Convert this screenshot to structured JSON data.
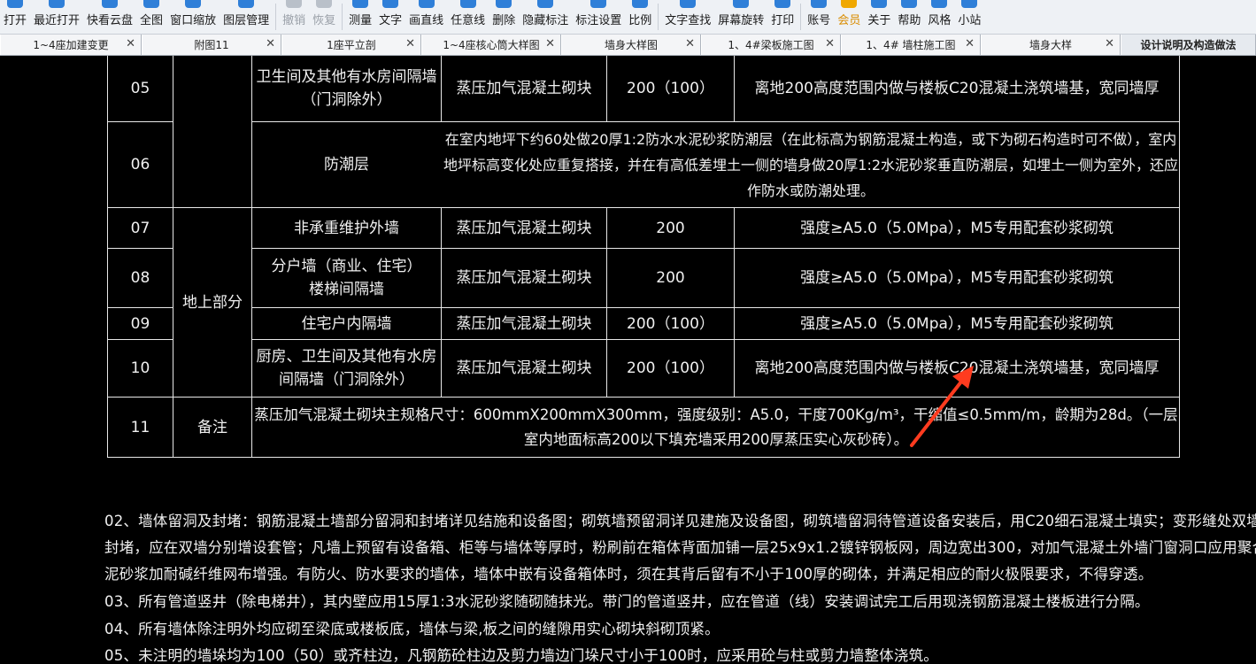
{
  "toolbar": {
    "buttons": [
      {
        "label": "打开",
        "icon": "folder-open-icon",
        "enabled": true
      },
      {
        "label": "最近打开",
        "icon": "recent-files-icon",
        "enabled": true
      },
      {
        "label": "快看云盘",
        "icon": "cloud-icon",
        "enabled": true
      },
      {
        "label": "全图",
        "icon": "fit-all-icon",
        "enabled": true
      },
      {
        "label": "窗口缩放",
        "icon": "zoom-window-icon",
        "enabled": true
      },
      {
        "label": "图层管理",
        "icon": "layers-icon",
        "enabled": true
      },
      {
        "label": "撤销",
        "icon": "undo-icon",
        "enabled": false
      },
      {
        "label": "恢复",
        "icon": "redo-icon",
        "enabled": false
      },
      {
        "label": "测量",
        "icon": "ruler-icon",
        "enabled": true
      },
      {
        "label": "文字",
        "icon": "text-icon",
        "enabled": true
      },
      {
        "label": "画直线",
        "icon": "line-icon",
        "enabled": true
      },
      {
        "label": "任意线",
        "icon": "freehand-icon",
        "enabled": true
      },
      {
        "label": "删除",
        "icon": "delete-icon",
        "enabled": true
      },
      {
        "label": "隐藏标注",
        "icon": "hide-annotation-icon",
        "enabled": true
      },
      {
        "label": "标注设置",
        "icon": "annotation-settings-icon",
        "enabled": true
      },
      {
        "label": "比例",
        "icon": "scale-icon",
        "enabled": true
      },
      {
        "label": "文字查找",
        "icon": "text-search-icon",
        "enabled": true
      },
      {
        "label": "屏幕旋转",
        "icon": "rotate-screen-icon",
        "enabled": true
      },
      {
        "label": "打印",
        "icon": "print-icon",
        "enabled": true
      },
      {
        "label": "账号",
        "icon": "account-icon",
        "enabled": true
      },
      {
        "label": "会员",
        "icon": "vip-icon",
        "enabled": true
      },
      {
        "label": "关于",
        "icon": "about-icon",
        "enabled": true
      },
      {
        "label": "帮助",
        "icon": "help-icon",
        "enabled": true
      },
      {
        "label": "风格",
        "icon": "style-icon",
        "enabled": true
      },
      {
        "label": "小站",
        "icon": "station-icon",
        "enabled": true
      }
    ]
  },
  "tabs": [
    {
      "label": "1~4座加建变更"
    },
    {
      "label": "附图11"
    },
    {
      "label": "1座平立剖"
    },
    {
      "label": "1~4座核心筒大样图"
    },
    {
      "label": "墙身大样图"
    },
    {
      "label": "1、4#梁板施工图"
    },
    {
      "label": "1、4# 墙柱施工图"
    },
    {
      "label": "墙身大样"
    },
    {
      "label": "设计说明及构造做法",
      "active": true
    }
  ],
  "table": {
    "rows": {
      "r05": {
        "no": "05",
        "name": "卫生间及其他有水房间隔墙（门洞除外）",
        "material": "蒸压加气混凝土砌块",
        "thickness": "200（100）",
        "note": "离地200高度范围内做与楼板C20混凝土浇筑墙基，宽同墙厚"
      },
      "r06": {
        "no": "06",
        "name": "防潮层",
        "desc": "在室内地坪下约60处做20厚1:2防水水泥砂浆防潮层（在此标高为钢筋混凝土构造，或下为砌石构造时可不做），室内地坪标高变化处应重复搭接，并在有高低差埋土一侧的墙身做20厚1:2水泥砂浆垂直防潮层，如埋土一侧为室外，还应作防水或防潮处理。"
      },
      "r07": {
        "no": "07",
        "name": "非承重维护外墙",
        "material": "蒸压加气混凝土砌块",
        "thickness": "200",
        "note": "强度≥A5.0（5.0Mpa），M5专用配套砂浆砌筑"
      },
      "r08": {
        "no": "08",
        "name": "分户墙（商业、住宅）楼梯间隔墙",
        "material": "蒸压加气混凝土砌块",
        "thickness": "200",
        "note": "强度≥A5.0（5.0Mpa），M5专用配套砂浆砌筑"
      },
      "r09": {
        "no": "09",
        "name": "住宅户内隔墙",
        "material": "蒸压加气混凝土砌块",
        "thickness": "200（100）",
        "note": "强度≥A5.0（5.0Mpa），M5专用配套砂浆砌筑"
      },
      "r10": {
        "no": "10",
        "name": "厨房、卫生间及其他有水房间隔墙（门洞除外）",
        "material": "蒸压加气混凝土砌块",
        "thickness": "200（100）",
        "note": "离地200高度范围内做与楼板C20混凝土浇筑墙基，宽同墙厚"
      },
      "r11": {
        "no": "11",
        "label": "备注",
        "text": "蒸压加气混凝土砌块主规格尺寸：600mmX200mmX300mm，强度级别：A5.0，干度700Kg/m³，干缩值≤0.5mm/m，龄期为28d。（一层室内地面标高200以下填充墙采用200厚蒸压实心灰砂砖）。"
      }
    },
    "group_above_ground": "地上部分"
  },
  "notes": [
    "02、墙体留洞及封堵：钢筋混凝土墙部分留洞和封堵详见结施和设备图；砌筑墙预留洞详见建施及设备图，砌筑墙留洞待管道设备安装后，用C20细石混凝土填实；变形缝处双墙留洞的",
    "封堵，应在双墙分别增设套管；凡墙上预留有设备箱、柜等与墙体等厚时，粉刷前在箱体背面加铺一层25x9x1.2镀锌钢板网，周边宽出300，对加气混凝土外墙门窗洞口应用聚合物水",
    "泥砂浆加耐碱纤维网布增强。有防火、防水要求的墙体，墙体中嵌有设备箱体时，须在其背后留有不小于100厚的砌体，并满足相应的耐火极限要求，不得穿透。",
    "03、所有管道竖井（除电梯井），其内壁应用15厚1:3水泥砂浆随砌随抹光。带门的管道竖井，应在管道（线）安装调试完工后用现浇钢筋混凝土楼板进行分隔。",
    "04、所有墙体除注明外均应砌至梁底或楼板底，墙体与梁,板之间的缝隙用实心砌块斜砌顶紧。",
    "05、未注明的墙垛均为100（50）或齐柱边，凡钢筋砼柱边及剪力墙边门垛尺寸小于100时，应采用砼与柱或剪力墙整体浇筑。"
  ],
  "colors": {
    "canvas": "#000000",
    "line": "#e8e8e8",
    "text": "#f0f0f0",
    "annotation": "#ff3b1f",
    "toolbar_bg": "#eef1f5"
  }
}
